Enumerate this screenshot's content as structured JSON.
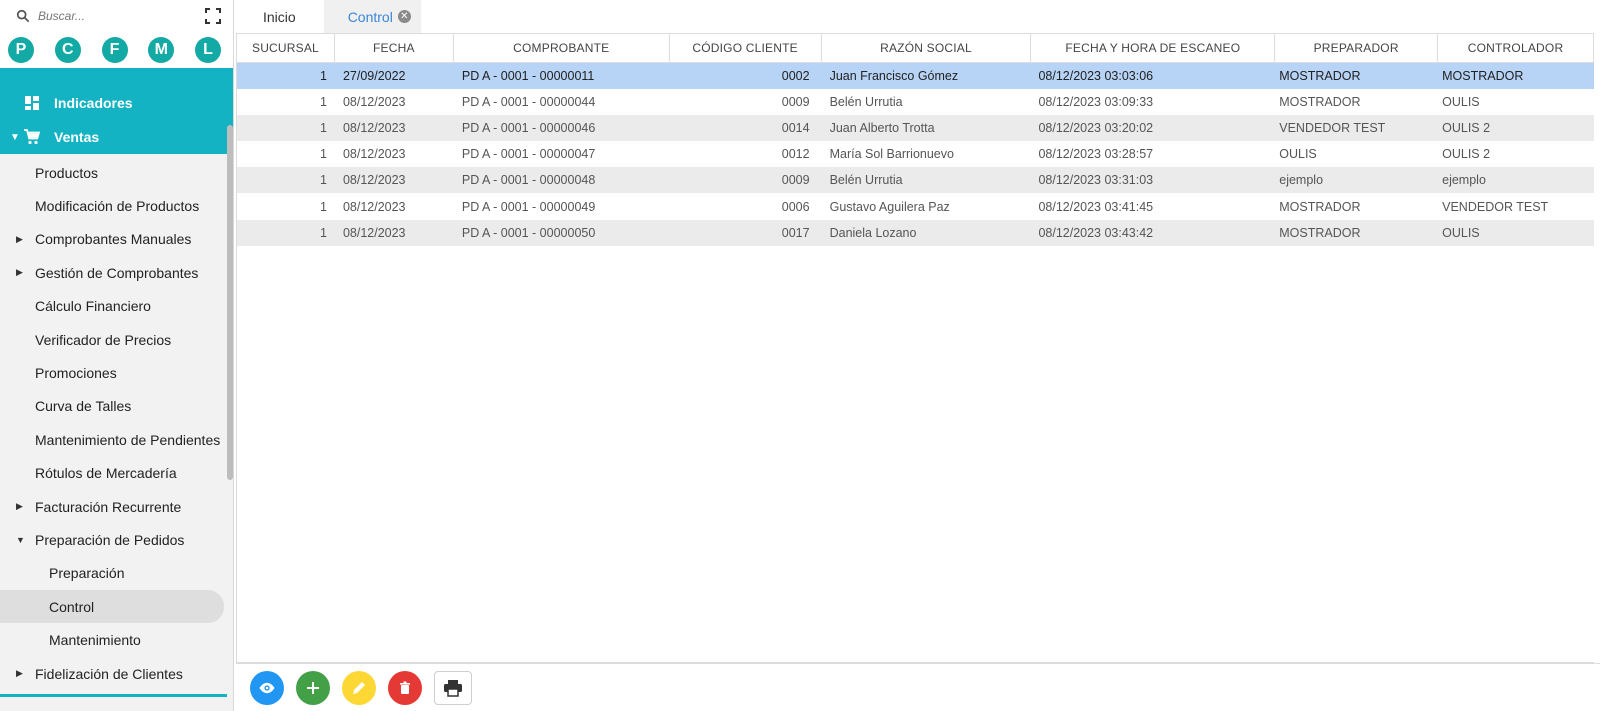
{
  "search": {
    "placeholder": "Buscar..."
  },
  "avatars": [
    "P",
    "C",
    "F",
    "M",
    "L"
  ],
  "sidebar": {
    "teal_items": [
      {
        "label": "Indicadores",
        "icon": "dashboard-icon"
      },
      {
        "label": "Ventas",
        "icon": "cart-icon",
        "expanded": true
      }
    ],
    "items": [
      {
        "label": "Productos",
        "caret": ""
      },
      {
        "label": "Modificación de Productos",
        "caret": ""
      },
      {
        "label": "Comprobantes Manuales",
        "caret": "right"
      },
      {
        "label": "Gestión de Comprobantes",
        "caret": "right"
      },
      {
        "label": "Cálculo Financiero",
        "caret": ""
      },
      {
        "label": "Verificador de Precios",
        "caret": ""
      },
      {
        "label": "Promociones",
        "caret": ""
      },
      {
        "label": "Curva de Talles",
        "caret": ""
      },
      {
        "label": "Mantenimiento de Pendientes",
        "caret": ""
      },
      {
        "label": "Rótulos de Mercadería",
        "caret": ""
      },
      {
        "label": "Facturación Recurrente",
        "caret": "right"
      },
      {
        "label": "Preparación de Pedidos",
        "caret": "down"
      },
      {
        "label": "Preparación",
        "caret": "",
        "sub": true
      },
      {
        "label": "Control",
        "caret": "",
        "sub": true,
        "active": true
      },
      {
        "label": "Mantenimiento",
        "caret": "",
        "sub": true
      },
      {
        "label": "Fidelización de Clientes",
        "caret": "right"
      }
    ]
  },
  "tabs": [
    {
      "label": "Inicio",
      "active": false
    },
    {
      "label": "Control",
      "active": true,
      "closable": true
    }
  ],
  "table": {
    "headers": [
      "SUCURSAL",
      "FECHA",
      "COMPROBANTE",
      "CÓDIGO CLIENTE",
      "RAZÓN SOCIAL",
      "FECHA Y HORA DE ESCANEO",
      "PREPARADOR",
      "CONTROLADOR"
    ],
    "rows": [
      [
        "1",
        "27/09/2022",
        "PD A - 0001 - 00000011",
        "0002",
        "Juan Francisco Gómez",
        "08/12/2023 03:03:06",
        "MOSTRADOR",
        "MOSTRADOR"
      ],
      [
        "1",
        "08/12/2023",
        "PD A - 0001 - 00000044",
        "0009",
        "Belén Urrutia",
        "08/12/2023 03:09:33",
        "MOSTRADOR",
        "OULIS"
      ],
      [
        "1",
        "08/12/2023",
        "PD A - 0001 - 00000046",
        "0014",
        "Juan Alberto Trotta",
        "08/12/2023 03:20:02",
        "VENDEDOR TEST",
        "OULIS 2"
      ],
      [
        "1",
        "08/12/2023",
        "PD A - 0001 - 00000047",
        "0012",
        "María Sol Barrionuevo",
        "08/12/2023 03:28:57",
        "OULIS",
        "OULIS 2"
      ],
      [
        "1",
        "08/12/2023",
        "PD A - 0001 - 00000048",
        "0009",
        "Belén Urrutia",
        "08/12/2023 03:31:03",
        "ejemplo",
        "ejemplo"
      ],
      [
        "1",
        "08/12/2023",
        "PD A - 0001 - 00000049",
        "0006",
        "Gustavo Aguilera Paz",
        "08/12/2023 03:41:45",
        "MOSTRADOR",
        "VENDEDOR TEST"
      ],
      [
        "1",
        "08/12/2023",
        "PD A - 0001 - 00000050",
        "0017",
        "Daniela Lozano",
        "08/12/2023 03:43:42",
        "MOSTRADOR",
        "OULIS"
      ]
    ],
    "selected_row": 0
  },
  "toolbar": {
    "buttons": [
      {
        "name": "view-button",
        "icon": "eye-icon",
        "color": "#2196f3"
      },
      {
        "name": "add-button",
        "icon": "plus-icon",
        "color": "#43a047"
      },
      {
        "name": "edit-button",
        "icon": "pencil-icon",
        "color": "#fdd835"
      },
      {
        "name": "delete-button",
        "icon": "trash-icon",
        "color": "#e53935"
      },
      {
        "name": "print-button",
        "icon": "printer-icon",
        "color": "#ffffff"
      }
    ]
  },
  "colors": {
    "accent": "#14b3c4",
    "avatar": "#13a9a4",
    "selected_row": "#b7d3f5",
    "active_tab_text": "#3a86d8"
  }
}
